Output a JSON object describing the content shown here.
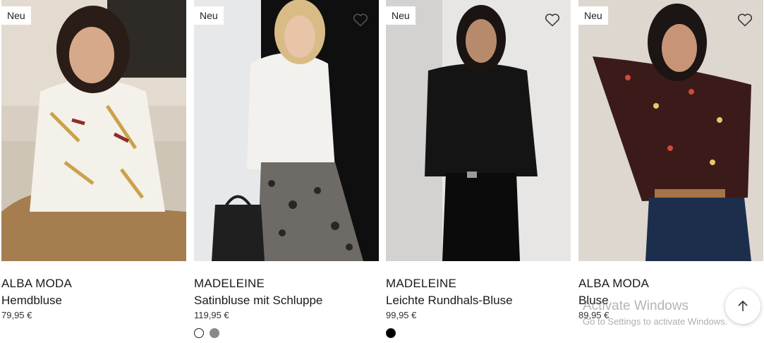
{
  "products": [
    {
      "badge": "Neu",
      "brand": "ALBA MODA",
      "name": "Hemdbluse",
      "price": "79,95 €",
      "swatches": [],
      "image": "woman-in-white-chain-print-blouse"
    },
    {
      "badge": "Neu",
      "brand": "MADELEINE",
      "name": "Satinbluse mit Schluppe",
      "price": "119,95 €",
      "swatches": [
        "#ffffff",
        "#8a8a8a"
      ],
      "image": "woman-in-white-bow-blouse-leopard-pants"
    },
    {
      "badge": "Neu",
      "brand": "MADELEINE",
      "name": "Leichte Rundhals-Bluse",
      "price": "99,95 €",
      "swatches": [
        "#000000"
      ],
      "image": "woman-in-black-ruffle-blouse"
    },
    {
      "badge": "Neu",
      "brand": "ALBA MODA",
      "name": "Bluse",
      "price": "89,95 €",
      "swatches": [],
      "image": "woman-in-patterned-red-blouse-jeans"
    }
  ],
  "overlay": {
    "activate_title": "Activate Windows",
    "activate_sub": "Go to Settings to activate Windows."
  },
  "icons": {
    "wishlist": "heart-icon",
    "scroll_top": "arrow-up-icon"
  }
}
